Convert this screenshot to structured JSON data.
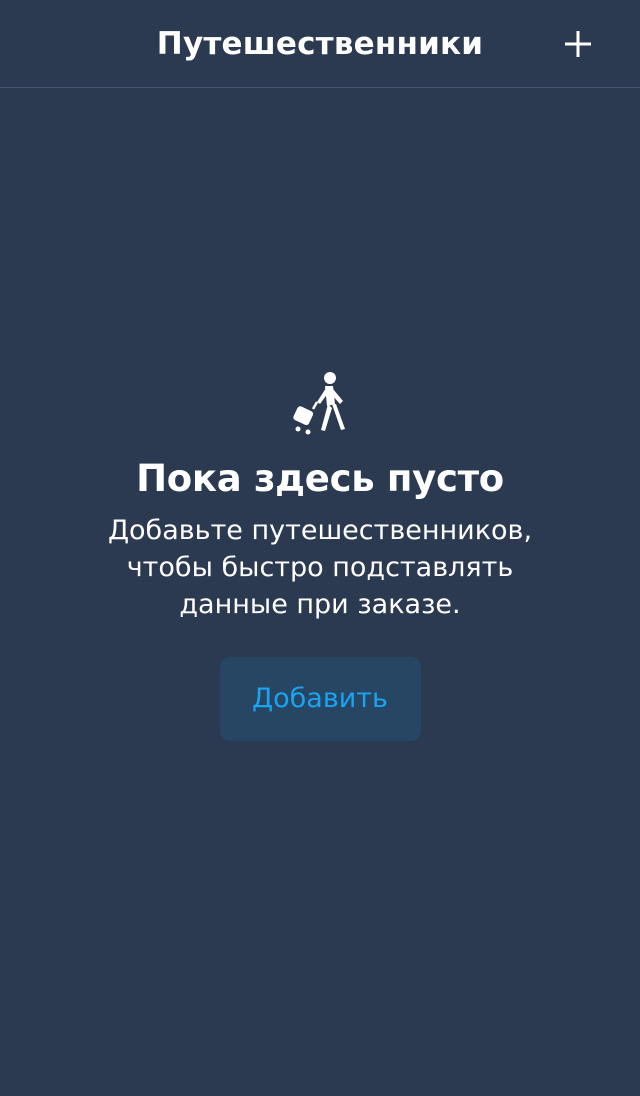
{
  "header": {
    "title": "Путешественники",
    "add_icon": "plus-icon"
  },
  "empty_state": {
    "icon": "traveler-with-luggage-icon",
    "title": "Пока здесь пусто",
    "description_lines": [
      "Добавьте путешественников,",
      "чтобы быстро подставлять",
      "данные при заказе."
    ],
    "button_label": "Добавить"
  },
  "colors": {
    "background": "#2b3a51",
    "divider": "#43536b",
    "button_bg": "#264663",
    "accent": "#1aa3f0",
    "text": "#ffffff"
  }
}
